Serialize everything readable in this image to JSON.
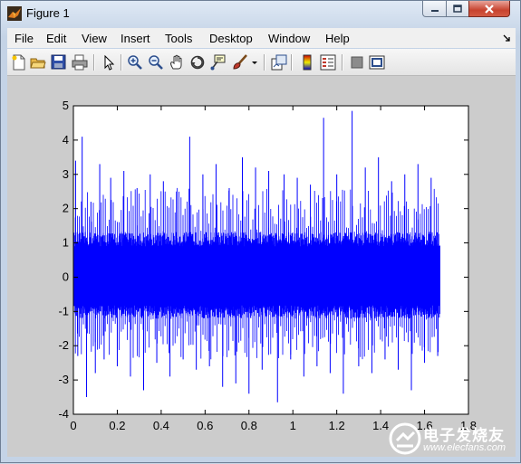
{
  "window": {
    "title": "Figure 1"
  },
  "menubar": {
    "items": [
      {
        "label": "File",
        "name": "menu-file"
      },
      {
        "label": "Edit",
        "name": "menu-edit"
      },
      {
        "label": "View",
        "name": "menu-view"
      },
      {
        "label": "Insert",
        "name": "menu-insert"
      },
      {
        "label": "Tools",
        "name": "menu-tools"
      },
      {
        "label": "Desktop",
        "name": "menu-desktop"
      },
      {
        "label": "Window",
        "name": "menu-window"
      },
      {
        "label": "Help",
        "name": "menu-help"
      }
    ]
  },
  "toolbar": {
    "icons": [
      "new-figure-icon",
      "open-file-icon",
      "save-icon",
      "print-icon",
      "edit-plot-arrow-icon",
      "zoom-in-icon",
      "zoom-out-icon",
      "pan-hand-icon",
      "rotate-3d-icon",
      "data-cursor-icon",
      "brush-icon",
      "brush-dropdown-icon",
      "link-plot-icon",
      "colorbar-icon",
      "legend-icon",
      "hide-plot-tools-icon",
      "show-plot-tools-icon"
    ]
  },
  "watermark": {
    "line1": "电子发烧友",
    "line2": "www.elecfans.com"
  },
  "colors": {
    "signal": "#0000ff",
    "figure_bg": "#cccccc",
    "axes_bg": "#ffffff"
  },
  "chart_data": {
    "type": "line",
    "title": "",
    "xlabel": "",
    "ylabel": "",
    "xlim": [
      0,
      1.8
    ],
    "ylim": [
      -4,
      5
    ],
    "x_ticks": [
      "0",
      "0.2",
      "0.4",
      "0.6",
      "0.8",
      "1",
      "1.2",
      "1.4",
      "1.6",
      "1.8"
    ],
    "y_ticks": [
      "-4",
      "-3",
      "-2",
      "-1",
      "0",
      "1",
      "2",
      "3",
      "4",
      "5"
    ],
    "grid": false,
    "series": [
      {
        "color": "#0000ff",
        "x_range": [
          0,
          1.67
        ],
        "band": [
          -1.1,
          1.2
        ],
        "description_values": {
          "max": 4.85,
          "min": -3.65
        },
        "spikes": [
          {
            "x": 0.01,
            "y": 3.4
          },
          {
            "x": 0.02,
            "y": -2.3
          },
          {
            "x": 0.04,
            "y": 4.1
          },
          {
            "x": 0.06,
            "y": -3.5
          },
          {
            "x": 0.08,
            "y": 2.2
          },
          {
            "x": 0.1,
            "y": -2.8
          },
          {
            "x": 0.12,
            "y": 3.3
          },
          {
            "x": 0.14,
            "y": -2.4
          },
          {
            "x": 0.17,
            "y": 2.9
          },
          {
            "x": 0.2,
            "y": -2.6
          },
          {
            "x": 0.23,
            "y": 3.1
          },
          {
            "x": 0.26,
            "y": -2.9
          },
          {
            "x": 0.29,
            "y": 2.6
          },
          {
            "x": 0.32,
            "y": -3.3
          },
          {
            "x": 0.35,
            "y": 3.0
          },
          {
            "x": 0.38,
            "y": -2.5
          },
          {
            "x": 0.41,
            "y": 2.8
          },
          {
            "x": 0.44,
            "y": -2.9
          },
          {
            "x": 0.47,
            "y": 2.5
          },
          {
            "x": 0.5,
            "y": -2.4
          },
          {
            "x": 0.53,
            "y": 4.1
          },
          {
            "x": 0.56,
            "y": -2.7
          },
          {
            "x": 0.59,
            "y": 3.0
          },
          {
            "x": 0.62,
            "y": -2.6
          },
          {
            "x": 0.65,
            "y": 3.3
          },
          {
            "x": 0.68,
            "y": -3.2
          },
          {
            "x": 0.71,
            "y": 2.6
          },
          {
            "x": 0.74,
            "y": -3.1
          },
          {
            "x": 0.77,
            "y": 3.5
          },
          {
            "x": 0.8,
            "y": -3.4
          },
          {
            "x": 0.83,
            "y": 3.2
          },
          {
            "x": 0.86,
            "y": -2.7
          },
          {
            "x": 0.89,
            "y": 3.1
          },
          {
            "x": 0.93,
            "y": -3.65
          },
          {
            "x": 0.96,
            "y": 3.0
          },
          {
            "x": 0.99,
            "y": -2.4
          },
          {
            "x": 1.02,
            "y": 2.9
          },
          {
            "x": 1.05,
            "y": -2.9
          },
          {
            "x": 1.08,
            "y": 2.7
          },
          {
            "x": 1.11,
            "y": -2.6
          },
          {
            "x": 1.14,
            "y": 4.65
          },
          {
            "x": 1.17,
            "y": -2.8
          },
          {
            "x": 1.2,
            "y": 3.0
          },
          {
            "x": 1.23,
            "y": -3.4
          },
          {
            "x": 1.27,
            "y": 4.85
          },
          {
            "x": 1.3,
            "y": -2.6
          },
          {
            "x": 1.33,
            "y": 3.2
          },
          {
            "x": 1.36,
            "y": -2.8
          },
          {
            "x": 1.39,
            "y": 3.5
          },
          {
            "x": 1.42,
            "y": -2.4
          },
          {
            "x": 1.45,
            "y": 2.8
          },
          {
            "x": 1.48,
            "y": -2.7
          },
          {
            "x": 1.51,
            "y": 3.0
          },
          {
            "x": 1.54,
            "y": -3.3
          },
          {
            "x": 1.57,
            "y": 3.3
          },
          {
            "x": 1.6,
            "y": -2.5
          },
          {
            "x": 1.63,
            "y": 2.9
          },
          {
            "x": 1.66,
            "y": -2.3
          }
        ]
      }
    ]
  }
}
